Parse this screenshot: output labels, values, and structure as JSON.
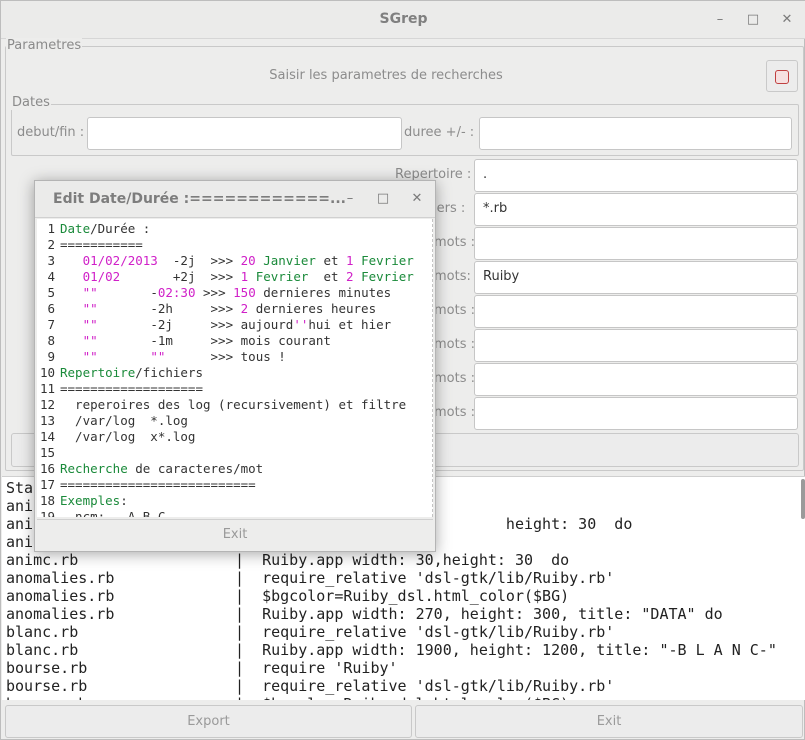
{
  "window": {
    "title": "SGrep"
  },
  "params": {
    "frame_label": "Parametres",
    "hint": "Saisir les parametres de recherches",
    "dates_label": "Dates",
    "debut_label": "debut/fin :",
    "duree_label": "duree +/- :",
    "repertoire_label": "Repertoire :",
    "fichiers_label": "iers :",
    "mots_label": "mots :",
    "mots_label2": "mots:",
    "repertoire_value": ".",
    "fichiers_value": "*.rb",
    "mots_value": "Ruiby"
  },
  "results": {
    "rows": [
      [
        "Sta",
        ""
      ],
      [
        "ani",
        ""
      ],
      [
        "ani",
        "                              height: 30  do"
      ],
      [
        "ani",
        ""
      ],
      [
        "animc.rb",
        "Ruiby.app width: 30,height: 30  do"
      ],
      [
        "anomalies.rb",
        "require_relative 'dsl-gtk/lib/Ruiby.rb'"
      ],
      [
        "anomalies.rb",
        "$bgcolor=Ruiby_dsl.html_color($BG)"
      ],
      [
        "anomalies.rb",
        "Ruiby.app width: 270, height: 300, title: \"DATA\" do"
      ],
      [
        "blanc.rb",
        "require_relative 'dsl-gtk/lib/Ruiby.rb'"
      ],
      [
        "blanc.rb",
        "Ruiby.app width: 1900, height: 1200, title: \"-B L A N C-\""
      ],
      [
        "bourse.rb",
        "require 'Ruiby'"
      ],
      [
        "bourse.rb",
        "require_relative 'dsl-gtk/lib/Ruiby.rb'"
      ],
      [
        "bourse.rb",
        "$bgcolor=Ruiby_dsl.html_color($BG)"
      ]
    ]
  },
  "footer": {
    "export_label": "Export",
    "exit_label": "Exit"
  },
  "dialog": {
    "title": "Edit Date/Durée :============...",
    "exit_label": "Exit",
    "lines": [
      [
        [
          "g",
          "Date"
        ],
        [
          "k",
          "/Durée :"
        ]
      ],
      [
        [
          "k",
          "==========="
        ]
      ],
      [
        [
          "k",
          "   "
        ],
        [
          "m",
          "01/02/2013"
        ],
        [
          "k",
          "  -2j  >>> "
        ],
        [
          "m",
          "20"
        ],
        [
          "k",
          " "
        ],
        [
          "g",
          "Janvier"
        ],
        [
          "k",
          " et "
        ],
        [
          "m",
          "1"
        ],
        [
          "k",
          " "
        ],
        [
          "g",
          "Fevrier"
        ]
      ],
      [
        [
          "k",
          "   "
        ],
        [
          "m",
          "01/02"
        ],
        [
          "k",
          "       +2j  >>> "
        ],
        [
          "m",
          "1"
        ],
        [
          "k",
          " "
        ],
        [
          "g",
          "Fevrier"
        ],
        [
          "k",
          "  et "
        ],
        [
          "m",
          "2"
        ],
        [
          "k",
          " "
        ],
        [
          "g",
          "Fevrier"
        ]
      ],
      [
        [
          "k",
          "   "
        ],
        [
          "m",
          "\"\""
        ],
        [
          "k",
          "       -"
        ],
        [
          "m",
          "02:30"
        ],
        [
          "k",
          " >>> "
        ],
        [
          "m",
          "150"
        ],
        [
          "k",
          " dernieres minutes"
        ]
      ],
      [
        [
          "k",
          "   "
        ],
        [
          "m",
          "\"\""
        ],
        [
          "k",
          "       -2h     >>> "
        ],
        [
          "m",
          "2"
        ],
        [
          "k",
          " dernieres heures"
        ]
      ],
      [
        [
          "k",
          "   "
        ],
        [
          "m",
          "\"\""
        ],
        [
          "k",
          "       -2j     >>> aujourd"
        ],
        [
          "m",
          "''"
        ],
        [
          "k",
          "hui et hier"
        ]
      ],
      [
        [
          "k",
          "   "
        ],
        [
          "m",
          "\"\""
        ],
        [
          "k",
          "       -1m     >>> mois courant"
        ]
      ],
      [
        [
          "k",
          "   "
        ],
        [
          "m",
          "\"\""
        ],
        [
          "k",
          "       "
        ],
        [
          "m",
          "\"\""
        ],
        [
          "k",
          "      >>> tous !"
        ]
      ],
      [
        [
          "g",
          "Repertoire"
        ],
        [
          "k",
          "/fichiers"
        ]
      ],
      [
        [
          "k",
          "==================="
        ]
      ],
      [
        [
          "k",
          "  reperoires des log (recursivement) et filtre"
        ]
      ],
      [
        [
          "k",
          "  /var/log  *.log"
        ]
      ],
      [
        [
          "k",
          "  /var/log  x*.log"
        ]
      ],
      [
        [
          "k",
          ""
        ]
      ],
      [
        [
          "g",
          "Recherche"
        ],
        [
          "k",
          " de caracteres/mot"
        ]
      ],
      [
        [
          "k",
          "=========================="
        ]
      ],
      [
        [
          "g",
          "Exemples"
        ],
        [
          "k",
          ":"
        ]
      ],
      [
        [
          "k",
          "  ncm:   A B C"
        ]
      ]
    ]
  },
  "colors": {
    "green": "#1a8a3a",
    "magenta": "#d020c8"
  }
}
